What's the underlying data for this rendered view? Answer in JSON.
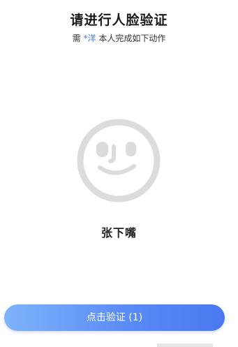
{
  "header": {
    "title": "请进行人脸验证",
    "subtitle_prefix": "需",
    "subtitle_name": "*洋",
    "subtitle_suffix": "本人完成如下动作"
  },
  "face": {
    "icon": "face-outline-icon",
    "color": "#dcdcdc"
  },
  "instruction": {
    "text": "张下嘴"
  },
  "button": {
    "label": "点击验证 (1)",
    "gradient_start": "#7fb3fb",
    "gradient_end": "#4b78ef"
  }
}
